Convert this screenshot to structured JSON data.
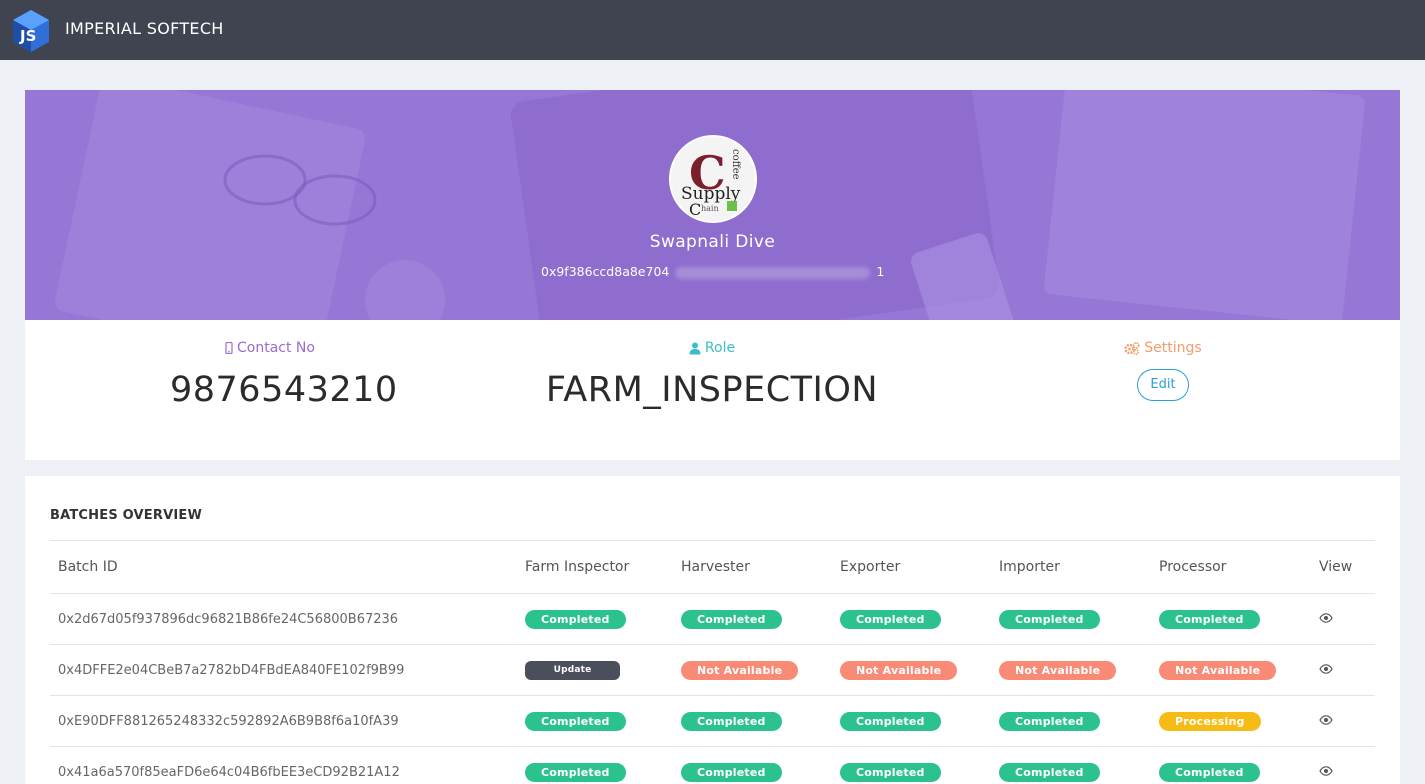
{
  "header": {
    "brand": "IMPERIAL SOFTECH",
    "logo_icon": "imperial-softech-logo"
  },
  "profile": {
    "name": "Swapnali Dive",
    "wallet_start": "0x9f386ccd8a8e704",
    "wallet_end": "1",
    "avatar_icon": "coffee-supply-chain-logo"
  },
  "info": {
    "contact_label": "Contact No",
    "contact_value": "9876543210",
    "role_label": "Role",
    "role_value": "FARM_INSPECTION",
    "settings_label": "Settings",
    "edit_label": "Edit"
  },
  "batches": {
    "title": "BATCHES OVERVIEW",
    "columns": [
      "Batch ID",
      "Farm Inspector",
      "Harvester",
      "Exporter",
      "Importer",
      "Processor",
      "View"
    ],
    "rows": [
      {
        "id": "0x2d67d05f937896dc96821B86fe24C56800B67236",
        "statuses": [
          "Completed",
          "Completed",
          "Completed",
          "Completed",
          "Completed"
        ]
      },
      {
        "id": "0x4DFFE2e04CBeB7a2782bD4FBdEA840FE102f9B99",
        "statuses": [
          "Update",
          "Not Available",
          "Not Available",
          "Not Available",
          "Not Available"
        ]
      },
      {
        "id": "0xE90DFF881265248332c592892A6B9B8f6a10fA39",
        "statuses": [
          "Completed",
          "Completed",
          "Completed",
          "Completed",
          "Processing"
        ]
      },
      {
        "id": "0x41a6a570f85eaFD6e64c04B6fbEE3eCD92B21A12",
        "statuses": [
          "Completed",
          "Completed",
          "Completed",
          "Completed",
          "Completed"
        ]
      }
    ]
  },
  "colors": {
    "topbar": "#3f4450",
    "hero": "#9777d6",
    "completed": "#2cc28e",
    "not_available": "#f98b76",
    "processing": "#f7bb16",
    "update": "#4a4f5c"
  }
}
